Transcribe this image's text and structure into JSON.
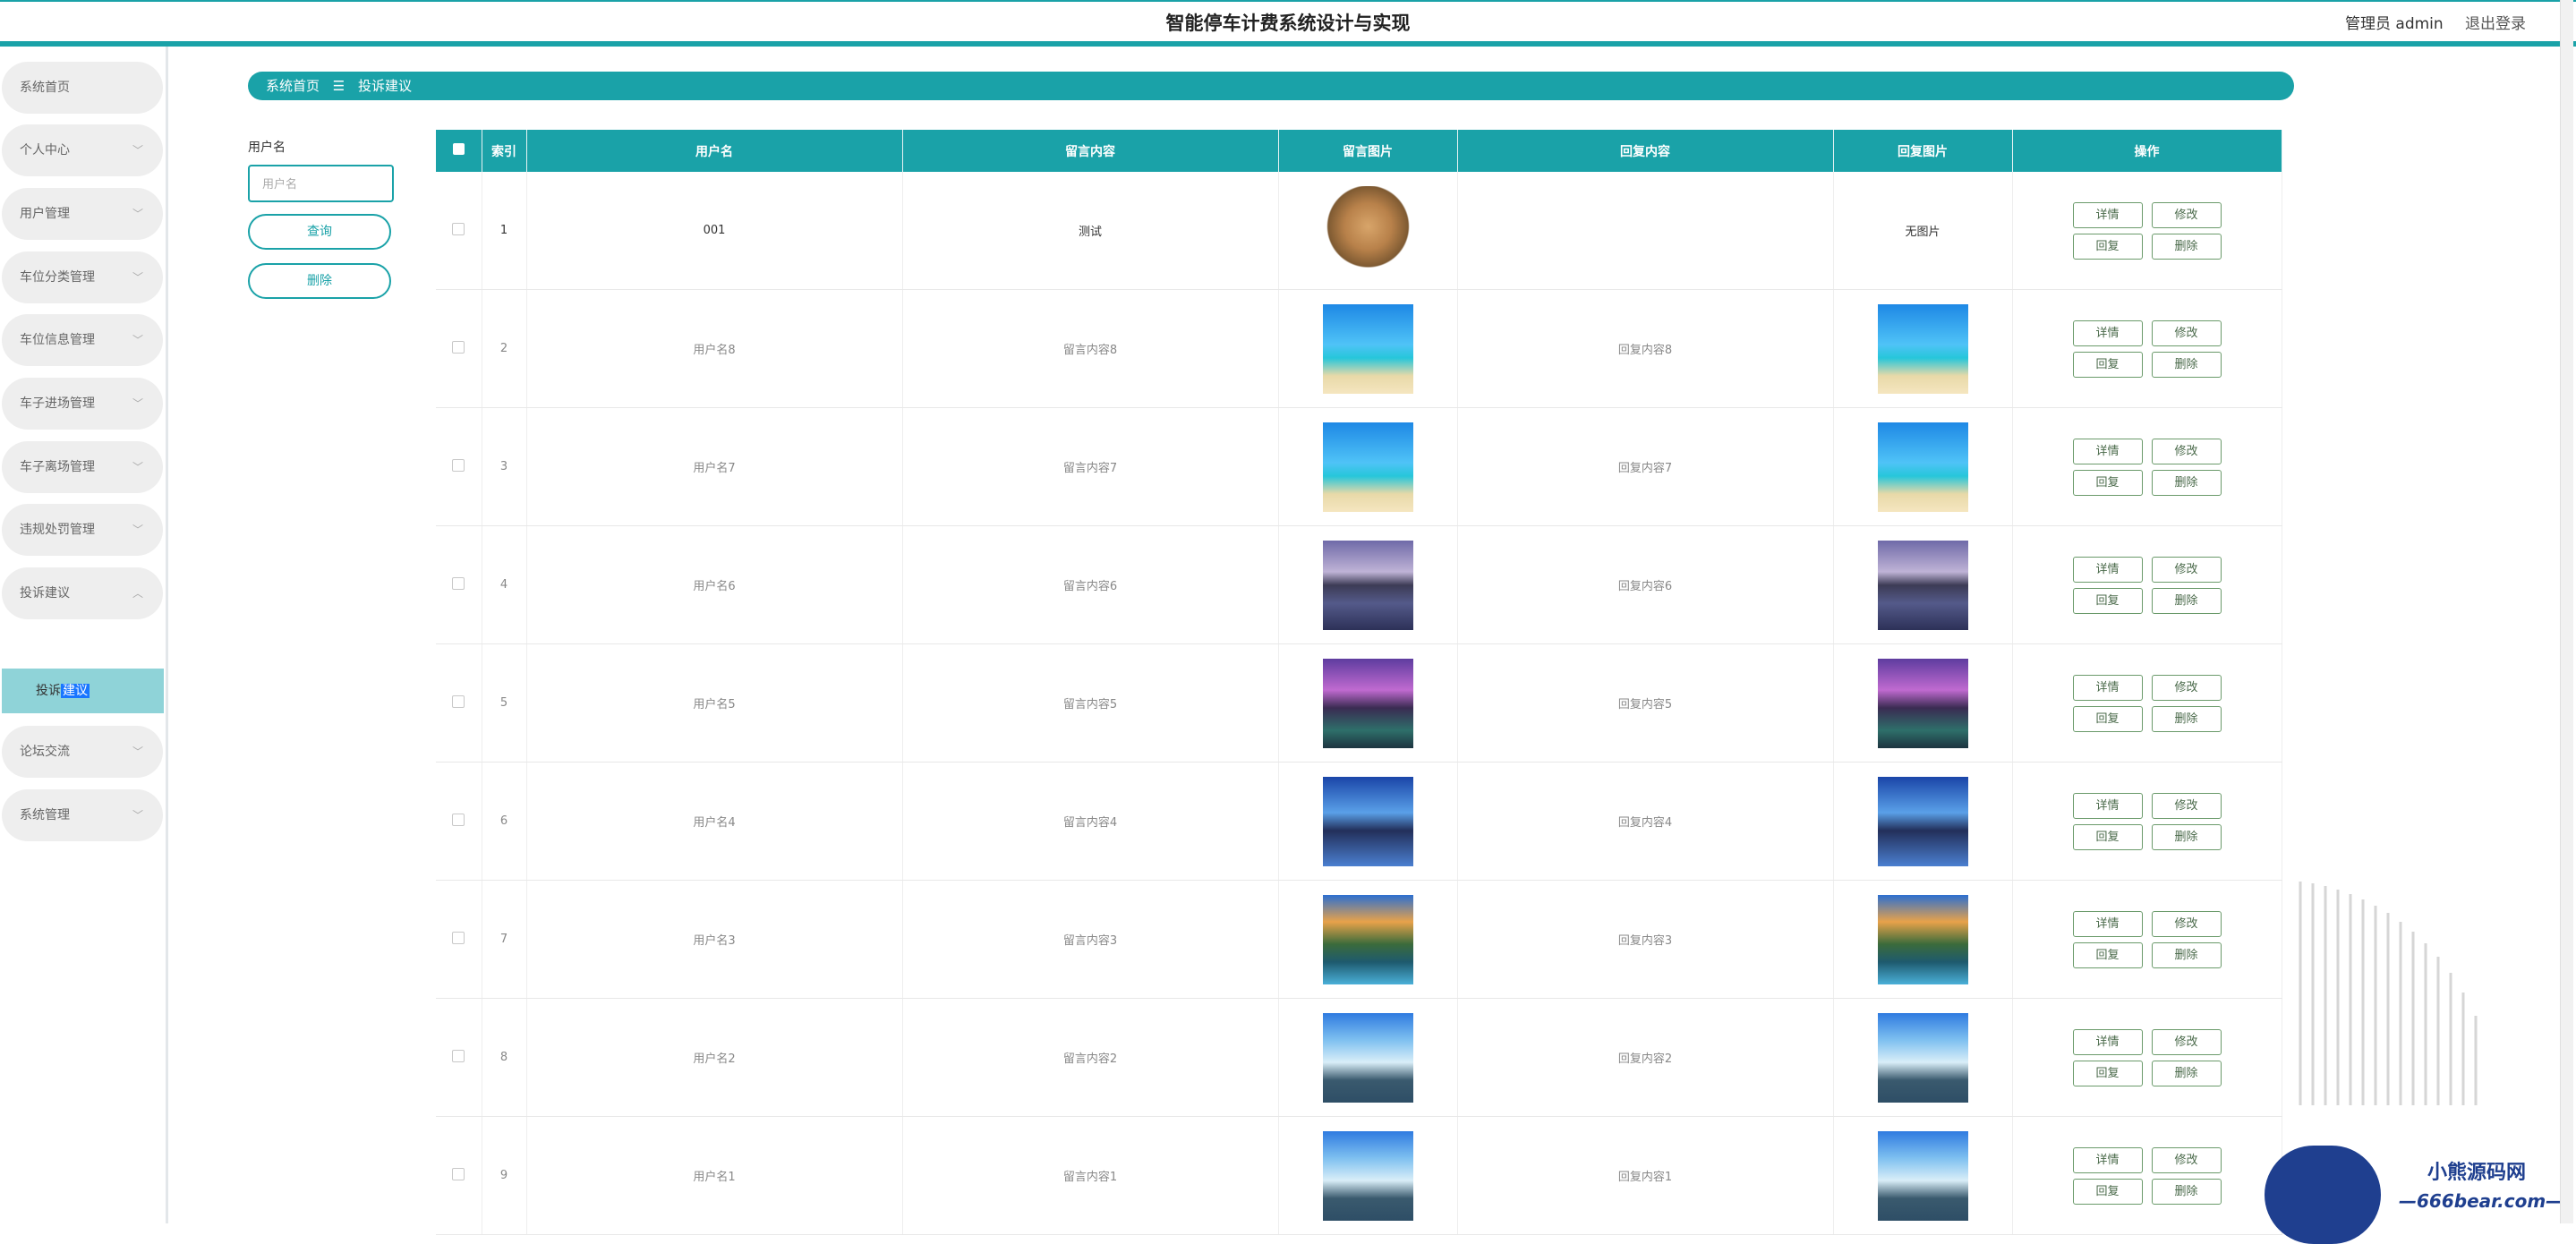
{
  "header": {
    "title": "智能停车计费系统设计与实现",
    "admin": "管理员 admin",
    "logout": "退出登录"
  },
  "sidebar": {
    "items": [
      {
        "label": "系统首页"
      },
      {
        "label": "个人中心"
      },
      {
        "label": "用户管理"
      },
      {
        "label": "车位分类管理"
      },
      {
        "label": "车位信息管理"
      },
      {
        "label": "车子进场管理"
      },
      {
        "label": "车子离场管理"
      },
      {
        "label": "违规处罚管理"
      },
      {
        "label": "投诉建议"
      },
      {
        "label": "论坛交流"
      },
      {
        "label": "系统管理"
      }
    ],
    "active_sub_a": "投诉",
    "active_sub_b": "建议"
  },
  "breadcrumb": {
    "home": "系统首页",
    "sep": "☰",
    "current": "投诉建议"
  },
  "search": {
    "label": "用户名",
    "placeholder": "用户名",
    "query_btn": "查询",
    "delete_btn": "删除"
  },
  "table": {
    "headers": [
      "索引",
      "用户名",
      "留言内容",
      "留言图片",
      "回复内容",
      "回复图片",
      "操作"
    ],
    "no_image": "无图片",
    "actions": {
      "detail": "详情",
      "edit": "修改",
      "reply": "回复",
      "delete": "删除"
    },
    "rows": [
      {
        "index": "1",
        "username": "001",
        "content": "测试",
        "reply": "",
        "image": "bunny",
        "reply_image": ""
      },
      {
        "index": "2",
        "username": "用户名8",
        "content": "留言内容8",
        "reply": "回复内容8",
        "image": "beach",
        "reply_image": "beach"
      },
      {
        "index": "3",
        "username": "用户名7",
        "content": "留言内容7",
        "reply": "回复内容7",
        "image": "beach",
        "reply_image": "beach"
      },
      {
        "index": "4",
        "username": "用户名6",
        "content": "留言内容6",
        "reply": "回复内容6",
        "image": "lake",
        "reply_image": "lake"
      },
      {
        "index": "5",
        "username": "用户名5",
        "content": "留言内容5",
        "reply": "回复内容5",
        "image": "rocks",
        "reply_image": "rocks"
      },
      {
        "index": "6",
        "username": "用户名4",
        "content": "留言内容4",
        "reply": "回复内容4",
        "image": "blue",
        "reply_image": "blue"
      },
      {
        "index": "7",
        "username": "用户名3",
        "content": "留言内容3",
        "reply": "回复内容3",
        "image": "mtn",
        "reply_image": "mtn"
      },
      {
        "index": "8",
        "username": "用户名2",
        "content": "留言内容2",
        "reply": "回复内容2",
        "image": "fall",
        "reply_image": "fall"
      },
      {
        "index": "9",
        "username": "用户名1",
        "content": "留言内容1",
        "reply": "回复内容1",
        "image": "fall",
        "reply_image": "fall"
      }
    ]
  },
  "watermark": {
    "title": "小熊源码网",
    "url": "—666bear.com—"
  },
  "colors": {
    "accent": "#1aa2a8",
    "active_submenu": "#8fd3d8",
    "logo": "#1f3f8f"
  }
}
